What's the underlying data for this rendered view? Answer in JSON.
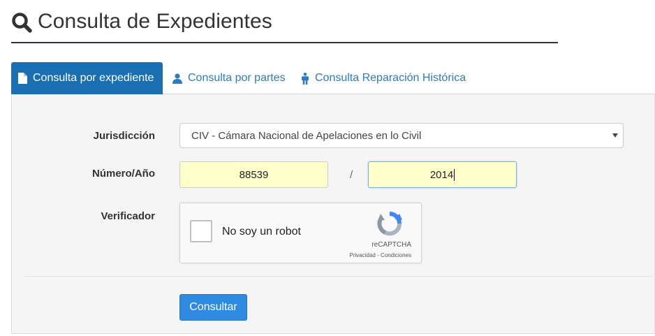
{
  "header": {
    "title": "Consulta de Expedientes"
  },
  "tabs": [
    {
      "label": "Consulta por expediente",
      "icon": "file-icon",
      "active": true
    },
    {
      "label": "Consulta por partes",
      "icon": "user-icon",
      "active": false
    },
    {
      "label": "Consulta Reparación Histórica",
      "icon": "person-icon",
      "active": false
    }
  ],
  "form": {
    "jurisdiccion_label": "Jurisdicción",
    "jurisdiccion_value": "CIV - Cámara Nacional de Apelaciones en lo Civil",
    "numero_label": "Número/Año",
    "numero_value": "88539",
    "separator": "/",
    "anio_value": "2014",
    "verificador_label": "Verificador",
    "submit_label": "Consultar"
  },
  "captcha": {
    "checkbox_label": "No soy un robot",
    "brand": "reCAPTCHA",
    "links": "Privacidad - Condiciones"
  },
  "colors": {
    "active_tab": "#1a6fb3",
    "link": "#2f7bbf",
    "input_bg": "#ffffcc",
    "button": "#2f8ae2"
  }
}
